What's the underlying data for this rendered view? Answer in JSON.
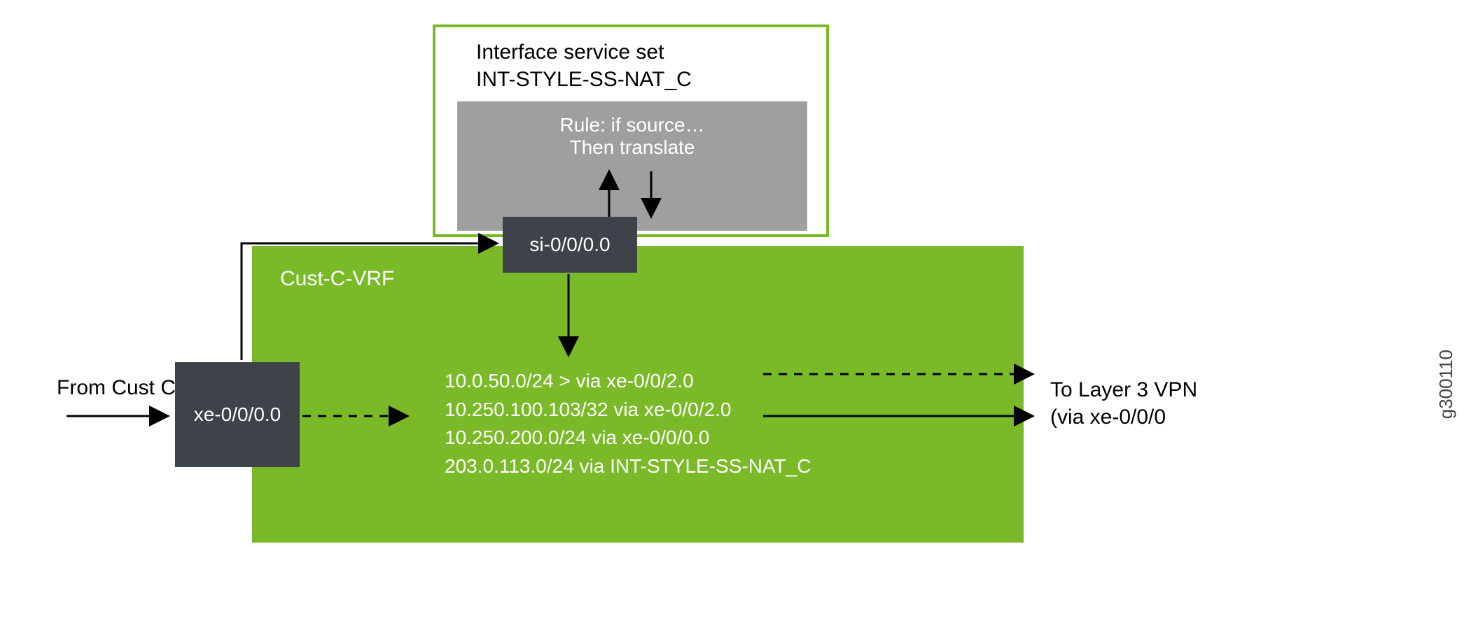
{
  "service_set": {
    "title_line1": "Interface service set",
    "title_line2": "INT-STYLE-SS-NAT_C",
    "rule_line1": "Rule: if source…",
    "rule_line2": "Then translate"
  },
  "si_interface": "si-0/0/0.0",
  "vrf": {
    "label": "Cust-C-VRF",
    "routes": [
      "10.0.50.0/24  > via xe-0/0/2.0",
      "10.250.100.103/32  via xe-0/0/2.0",
      "10.250.200.0/24 via xe-0/0/0.0",
      "203.0.113.0/24 via INT-STYLE-SS-NAT_C"
    ]
  },
  "xe_interface": "xe-0/0/0.0",
  "ingress_label": "From Cust C",
  "egress_label_line1": "To Layer 3 VPN",
  "egress_label_line2": "(via xe-0/0/0",
  "figure_code": "g300110"
}
